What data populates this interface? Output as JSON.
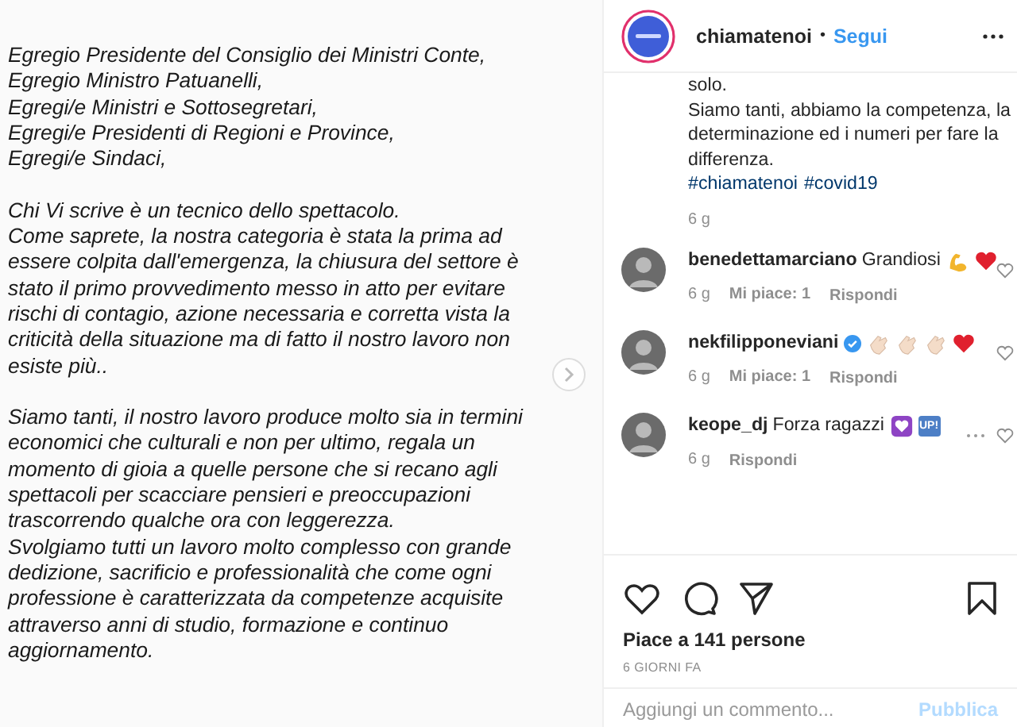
{
  "post_image": {
    "paragraphs": [
      [
        "Egregio Presidente del Consiglio dei Ministri Conte,",
        "Egregio Ministro Patuanelli,",
        "Egregi/e Ministri e Sottosegretari,",
        "Egregi/e Presidenti di Regioni e Province,",
        "Egregi/e Sindaci,"
      ],
      [
        "Chi Vi scrive è un tecnico dello spettacolo.",
        "Come saprete, la nostra categoria è stata la prima ad",
        "essere colpita dall'emergenza, la chiusura del settore è",
        "stato il primo provvedimento messo in atto per evitare",
        "rischi di contagio, azione necessaria e corretta vista la",
        "criticità della situazione ma di fatto il nostro lavoro non",
        "esiste più.."
      ],
      [
        "Siamo tanti, il nostro lavoro produce molto sia in termini",
        "economici che culturali e non per ultimo, regala un",
        "momento di gioia a quelle persone che si recano agli",
        "spettacoli per scacciare pensieri e preoccupazioni",
        "trascorrendo qualche ora con leggerezza.",
        "Svolgiamo tutti un lavoro molto complesso con grande",
        "dedizione, sacrificio e professionalità che come ogni",
        "professione è caratterizzata da competenze acquisite",
        "attraverso anni di studio, formazione e continuo",
        "aggiornamento."
      ]
    ]
  },
  "header": {
    "username": "chiamatenoi",
    "separator": "•",
    "follow": "Segui"
  },
  "caption": {
    "lines": [
      "solo.",
      "Siamo tanti, abbiamo la competenza, la",
      "determinazione ed i numeri per fare la",
      "differenza."
    ],
    "hashtags": [
      "#chiamatenoi",
      "#covid19"
    ],
    "time": "6 g"
  },
  "comments": [
    {
      "username": "benedettamarciano",
      "verified": false,
      "text": "Grandiosi",
      "emojis": [
        {
          "kind": "muscle"
        },
        {
          "kind": "heart"
        }
      ],
      "time": "6 g",
      "likes": "Mi piace: 1",
      "reply": "Rispondi",
      "more": false
    },
    {
      "username": "nekfilipponeviani",
      "verified": true,
      "emojis": [
        {
          "kind": "clap"
        },
        {
          "kind": "clap"
        },
        {
          "kind": "clap"
        },
        {
          "kind": "heart"
        }
      ],
      "time": "6 g",
      "likes": "Mi piace: 1",
      "reply": "Rispondi",
      "more": false
    },
    {
      "username": "keope_dj",
      "verified": false,
      "text": "Forza ragazzi",
      "emojis": [
        {
          "kind": "purple-heart"
        },
        {
          "kind": "up",
          "label": "UP!"
        }
      ],
      "time": "6 g",
      "reply": "Rispondi",
      "more": true
    }
  ],
  "likes": "Piace a 141 persone",
  "date": "6 GIORNI FA",
  "comment_box": {
    "placeholder": "Aggiungi un commento...",
    "submit": "Pubblica"
  }
}
